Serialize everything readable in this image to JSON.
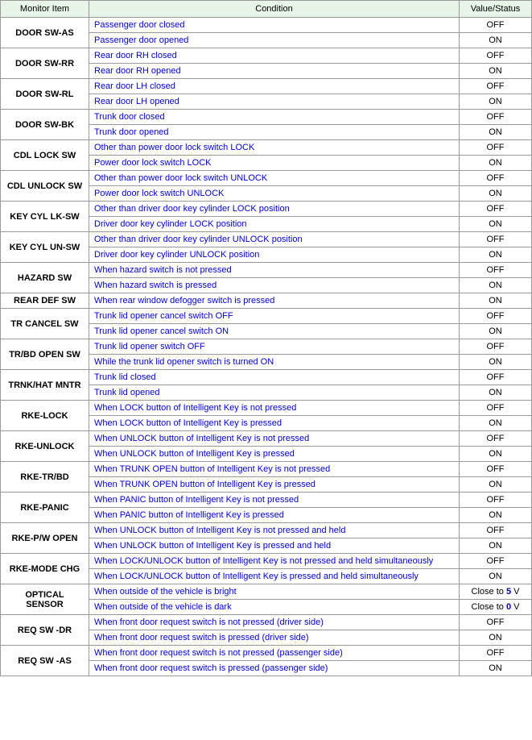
{
  "table": {
    "headers": {
      "monitor": "Monitor Item",
      "condition": "Condition",
      "value": "Value/Status"
    },
    "rows": [
      {
        "monitor": "DOOR SW-AS",
        "conditions": [
          {
            "condition": "Passenger door closed",
            "value": "OFF"
          },
          {
            "condition": "Passenger door opened",
            "value": "ON"
          }
        ]
      },
      {
        "monitor": "DOOR SW-RR",
        "conditions": [
          {
            "condition": "Rear door RH closed",
            "value": "OFF"
          },
          {
            "condition": "Rear door RH opened",
            "value": "ON"
          }
        ]
      },
      {
        "monitor": "DOOR SW-RL",
        "conditions": [
          {
            "condition": "Rear door LH closed",
            "value": "OFF"
          },
          {
            "condition": "Rear door LH opened",
            "value": "ON"
          }
        ]
      },
      {
        "monitor": "DOOR SW-BK",
        "conditions": [
          {
            "condition": "Trunk door closed",
            "value": "OFF"
          },
          {
            "condition": "Trunk door opened",
            "value": "ON"
          }
        ]
      },
      {
        "monitor": "CDL LOCK SW",
        "conditions": [
          {
            "condition": "Other than power door lock switch LOCK",
            "value": "OFF"
          },
          {
            "condition": "Power door lock switch LOCK",
            "value": "ON"
          }
        ]
      },
      {
        "monitor": "CDL UNLOCK SW",
        "conditions": [
          {
            "condition": "Other than power door lock switch UNLOCK",
            "value": "OFF"
          },
          {
            "condition": "Power door lock switch UNLOCK",
            "value": "ON"
          }
        ]
      },
      {
        "monitor": "KEY CYL LK-SW",
        "conditions": [
          {
            "condition": "Other than driver door key cylinder LOCK position",
            "value": "OFF"
          },
          {
            "condition": "Driver door key cylinder LOCK position",
            "value": "ON"
          }
        ]
      },
      {
        "monitor": "KEY CYL UN-SW",
        "conditions": [
          {
            "condition": "Other than driver door key cylinder UNLOCK position",
            "value": "OFF"
          },
          {
            "condition": "Driver door key cylinder UNLOCK position",
            "value": "ON"
          }
        ]
      },
      {
        "monitor": "HAZARD SW",
        "conditions": [
          {
            "condition": "When hazard switch is not pressed",
            "value": "OFF"
          },
          {
            "condition": "When hazard switch is pressed",
            "value": "ON"
          }
        ]
      },
      {
        "monitor": "REAR DEF SW",
        "conditions": [
          {
            "condition": "When rear window defogger switch is pressed",
            "value": "ON"
          }
        ]
      },
      {
        "monitor": "TR CANCEL SW",
        "conditions": [
          {
            "condition": "Trunk lid opener cancel switch OFF",
            "value": "OFF"
          },
          {
            "condition": "Trunk lid opener cancel switch ON",
            "value": "ON"
          }
        ]
      },
      {
        "monitor": "TR/BD OPEN SW",
        "conditions": [
          {
            "condition": "Trunk lid opener switch OFF",
            "value": "OFF"
          },
          {
            "condition": "While the trunk lid opener switch is turned ON",
            "value": "ON"
          }
        ]
      },
      {
        "monitor": "TRNK/HAT MNTR",
        "conditions": [
          {
            "condition": "Trunk lid closed",
            "value": "OFF"
          },
          {
            "condition": "Trunk lid opened",
            "value": "ON"
          }
        ]
      },
      {
        "monitor": "RKE-LOCK",
        "conditions": [
          {
            "condition": "When LOCK button of Intelligent Key is not pressed",
            "value": "OFF"
          },
          {
            "condition": "When LOCK button of Intelligent Key is pressed",
            "value": "ON"
          }
        ]
      },
      {
        "monitor": "RKE-UNLOCK",
        "conditions": [
          {
            "condition": "When UNLOCK button of Intelligent Key is not pressed",
            "value": "OFF"
          },
          {
            "condition": "When UNLOCK button of Intelligent Key is pressed",
            "value": "ON"
          }
        ]
      },
      {
        "monitor": "RKE-TR/BD",
        "conditions": [
          {
            "condition": "When TRUNK OPEN button of Intelligent Key is not pressed",
            "value": "OFF"
          },
          {
            "condition": "When TRUNK OPEN button of Intelligent Key is pressed",
            "value": "ON"
          }
        ]
      },
      {
        "monitor": "RKE-PANIC",
        "conditions": [
          {
            "condition": "When PANIC button of Intelligent Key is not pressed",
            "value": "OFF"
          },
          {
            "condition": "When PANIC button of Intelligent Key is pressed",
            "value": "ON"
          }
        ]
      },
      {
        "monitor": "RKE-P/W OPEN",
        "conditions": [
          {
            "condition": "When UNLOCK button of Intelligent Key is not pressed and held",
            "value": "OFF"
          },
          {
            "condition": "When UNLOCK button of Intelligent Key is pressed and held",
            "value": "ON"
          }
        ]
      },
      {
        "monitor": "RKE-MODE CHG",
        "conditions": [
          {
            "condition": "When LOCK/UNLOCK button of Intelligent Key is not pressed and held simultaneously",
            "value": "OFF"
          },
          {
            "condition": "When LOCK/UNLOCK button of Intelligent Key is pressed and held simultaneously",
            "value": "ON"
          }
        ]
      },
      {
        "monitor": "OPTICAL SENSOR",
        "conditions": [
          {
            "condition": "When outside of the vehicle is bright",
            "value": "Close to 5 V"
          },
          {
            "condition": "When outside of the vehicle is dark",
            "value": "Close to 0 V"
          }
        ]
      },
      {
        "monitor": "REQ SW -DR",
        "conditions": [
          {
            "condition": "When front door request switch is not pressed (driver side)",
            "value": "OFF"
          },
          {
            "condition": "When front door request switch is pressed (driver side)",
            "value": "ON"
          }
        ]
      },
      {
        "monitor": "REQ SW -AS",
        "conditions": [
          {
            "condition": "When front door request switch is not pressed (passenger side)",
            "value": "OFF"
          },
          {
            "condition": "When front door request switch is pressed (passenger side)",
            "value": "ON"
          }
        ]
      }
    ]
  }
}
